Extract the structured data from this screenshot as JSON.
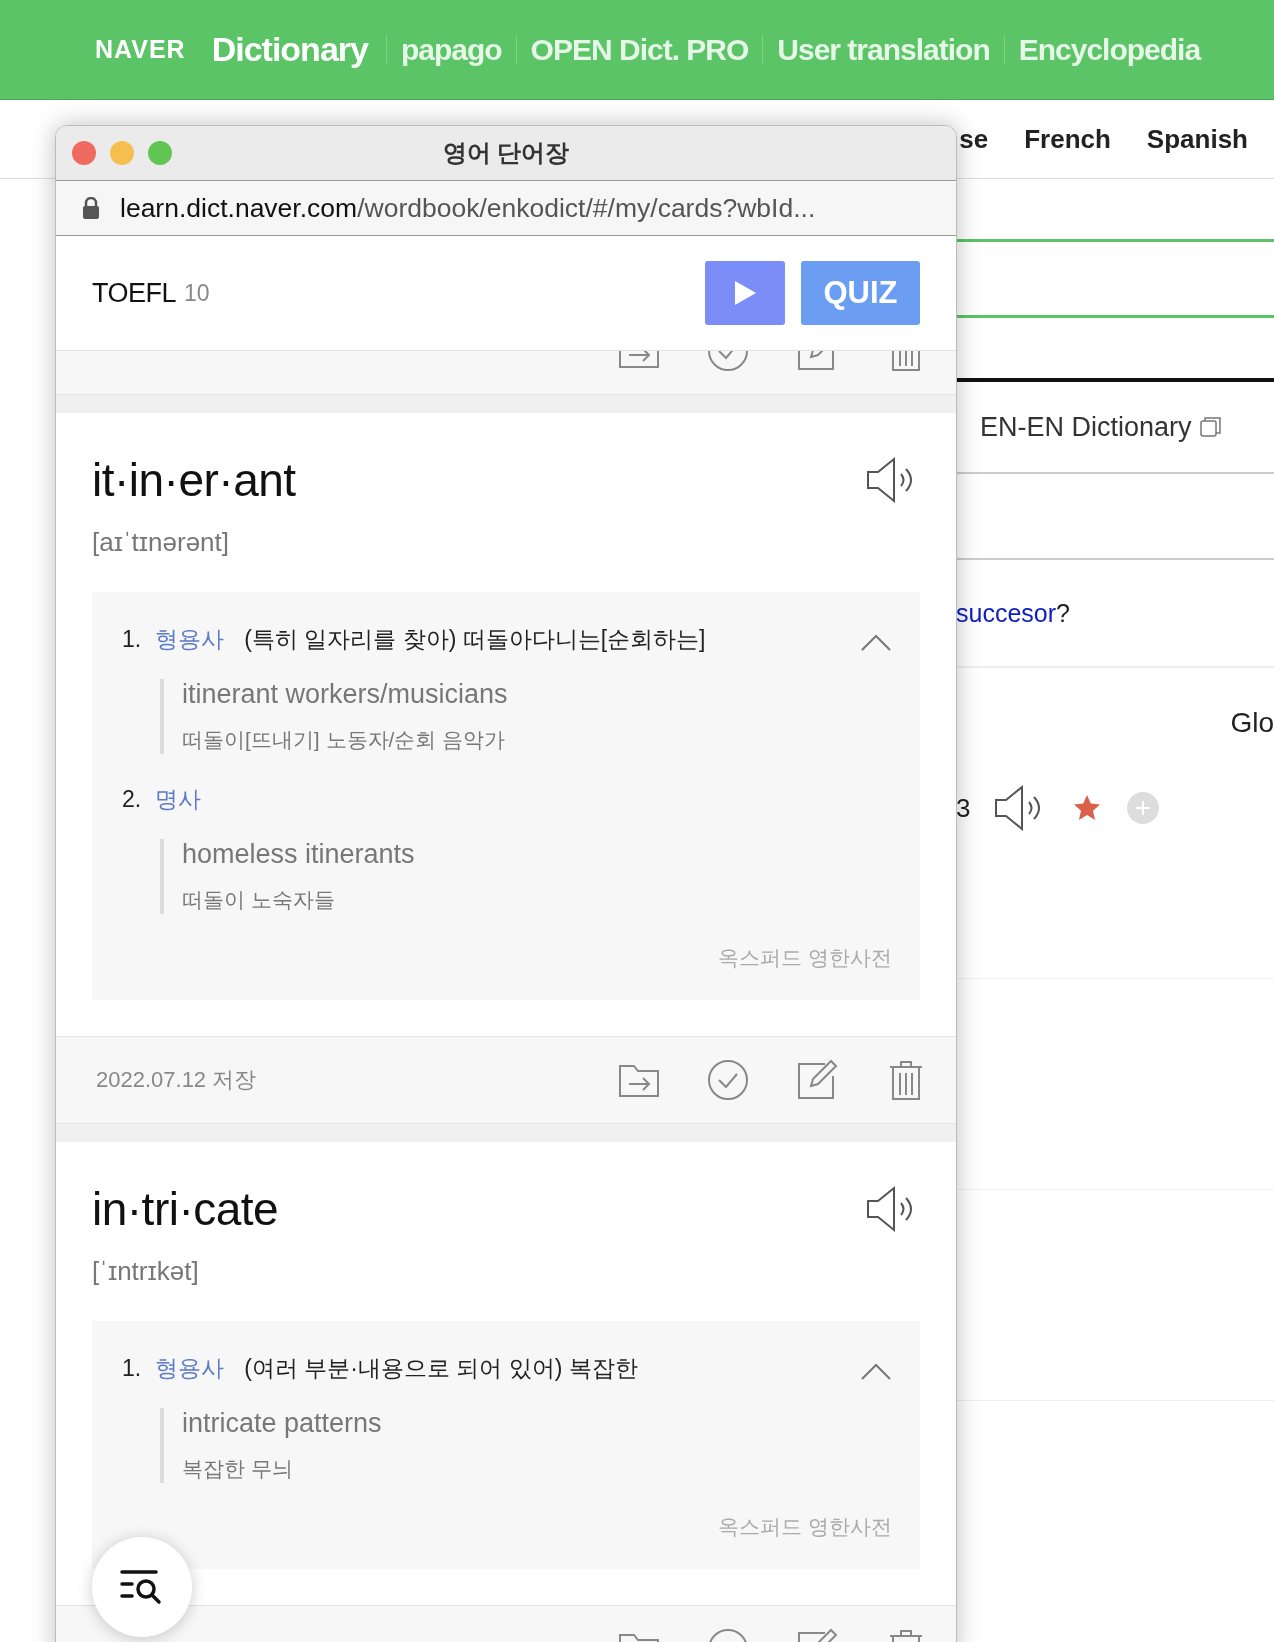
{
  "site_header": {
    "logo": "NAVER",
    "title": "Dictionary",
    "links": [
      "papago",
      "OPEN Dict. PRO",
      "User translation",
      "Encyclopedia"
    ]
  },
  "language_tabs": [
    "se",
    "French",
    "Spanish"
  ],
  "background_panel": {
    "dictionary_link": "EN-EN Dictionary",
    "suggestion_link": "succesor",
    "suggestion_mark": "?",
    "partial_heading": "Glo",
    "partial_number": "3",
    "starred": true
  },
  "popup": {
    "title": "영어 단어장",
    "url_host": "learn.dict.naver.com",
    "url_path": "/wordbook/enkodict/#/my/cards?wbId...",
    "wordbook": "TOEFL",
    "count": "10",
    "quiz_label": "QUIZ",
    "cards": [
      {
        "word": "it·in·er·ant",
        "phonetic": "[aɪˈtɪnərənt]",
        "senses": [
          {
            "number": "1.",
            "pos": "형용사",
            "meaning": "(특히 일자리를 찾아) 떠돌아다니는[순회하는]",
            "example": "itinerant workers/musicians",
            "translation": "떠돌이[뜨내기] 노동자/순회 음악가"
          },
          {
            "number": "2.",
            "pos": "명사",
            "example": "homeless itinerants",
            "translation": "떠돌이 노숙자들"
          }
        ],
        "source": "옥스퍼드 영한사전",
        "date": "2022.07.12 저장"
      },
      {
        "word": "in·tri·cate",
        "phonetic": "[ˈɪntrɪkət]",
        "senses": [
          {
            "number": "1.",
            "pos": "형용사",
            "meaning": "(여러 부분·내용으로 되어 있어) 복잡한",
            "example": "intricate patterns",
            "translation": "복잡한 무늬"
          }
        ],
        "source": "옥스퍼드 영한사전"
      }
    ]
  }
}
